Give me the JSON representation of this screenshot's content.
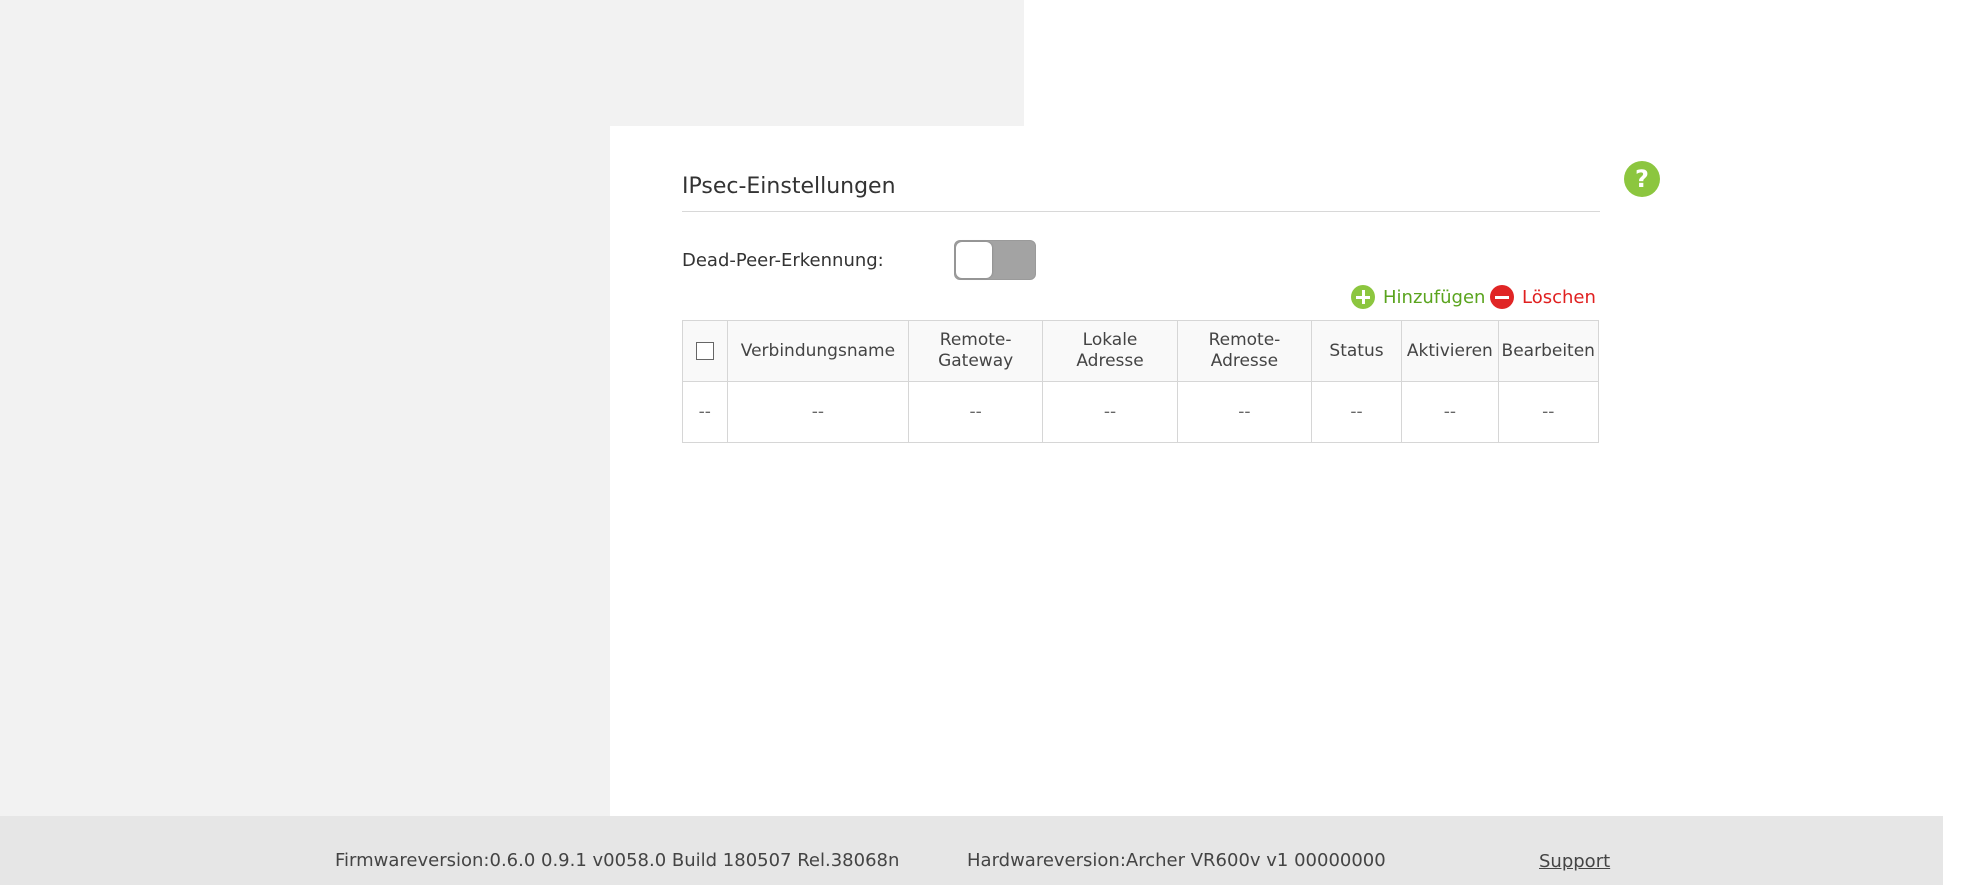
{
  "section": {
    "title": "IPsec-Einstellungen",
    "help_symbol": "?"
  },
  "dead_peer": {
    "label": "Dead-Peer-Erkennung:",
    "enabled": false
  },
  "actions": {
    "add_label": "Hinzufügen",
    "delete_label": "Löschen"
  },
  "table": {
    "headers": [
      "Verbindungsname",
      "Remote-Gateway",
      "Lokale Adresse",
      "Remote-Adresse",
      "Status",
      "Aktivieren",
      "Bearbeiten"
    ],
    "header_lines": {
      "remote_gateway": [
        "Remote-",
        "Gateway"
      ],
      "lokale_adresse": [
        "Lokale",
        "Adresse"
      ],
      "remote_adresse": [
        "Remote-",
        "Adresse"
      ]
    },
    "empty_row": [
      "--",
      "--",
      "--",
      "--",
      "--",
      "--",
      "--",
      "--"
    ]
  },
  "footer": {
    "firmware": "Firmwareversion:0.6.0 0.9.1 v0058.0 Build 180507 Rel.38068n",
    "hardware": "Hardwareversion:Archer VR600v v1 00000000",
    "support": "Support"
  },
  "colors": {
    "accent_green": "#8cc63f",
    "delete_red": "#e02525",
    "background_gray": "#f2f2f2",
    "footer_gray": "#e6e6e6"
  },
  "icons": {
    "help": "help-icon",
    "add": "plus-circle-icon",
    "delete": "minus-circle-icon"
  }
}
